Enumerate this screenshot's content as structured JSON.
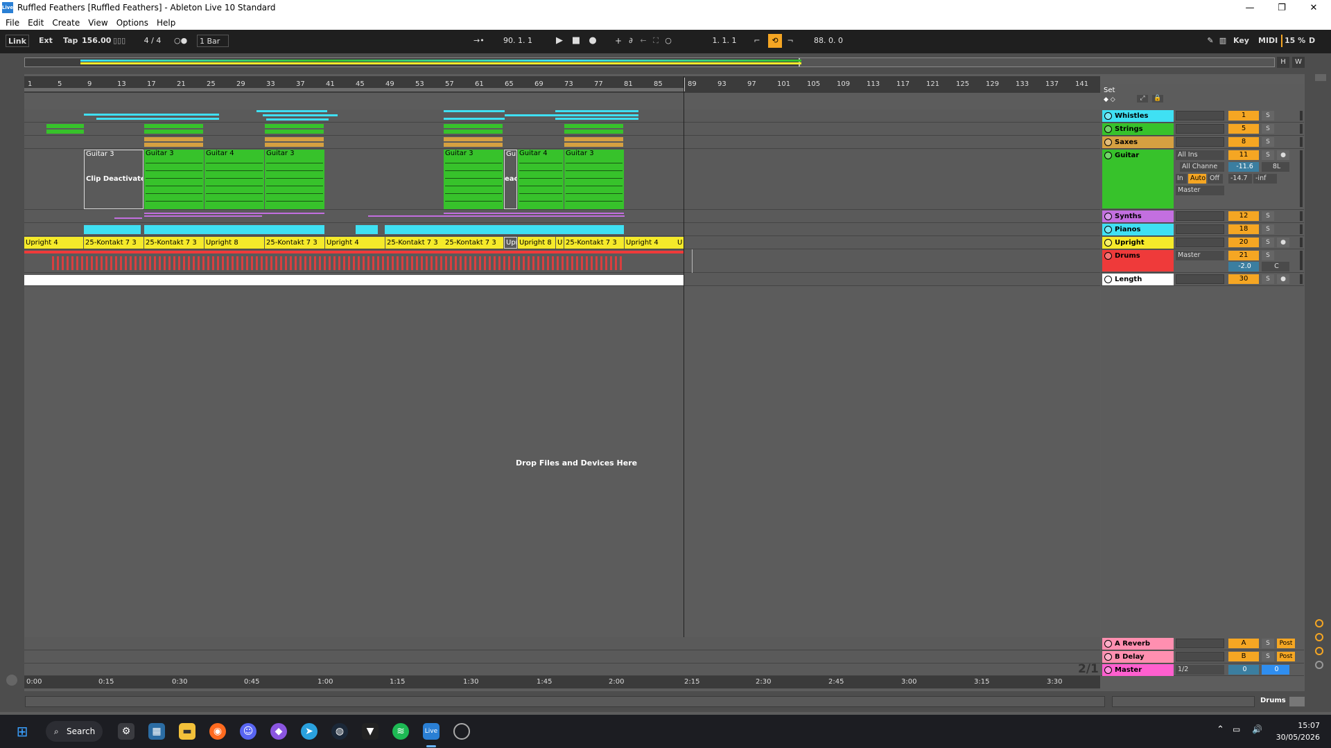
{
  "window": {
    "title": "Ruffled Feathers  [Ruffled Feathers] - Ableton Live 10 Standard",
    "app_icon": "Live",
    "minimize": "—",
    "maximize": "❐",
    "close": "✕"
  },
  "menu": [
    "File",
    "Edit",
    "Create",
    "View",
    "Options",
    "Help"
  ],
  "transport": {
    "link": "Link",
    "ext": "Ext",
    "tap": "Tap",
    "tempo": "156.00",
    "time_sig": "4 / 4",
    "metronome": "○●",
    "quantize": "1 Bar",
    "arrangement_pos": "90.  1.  1",
    "loop_start": "1.  1.  1",
    "loop_length": "88.  0.  0",
    "key": "Key",
    "midi": "MIDI",
    "cpu": "15 %",
    "d": "D"
  },
  "overview": {
    "h": "H",
    "w": "W"
  },
  "ruler": {
    "bars": [
      "1",
      "5",
      "9",
      "13",
      "17",
      "21",
      "25",
      "29",
      "33",
      "37",
      "41",
      "45",
      "49",
      "53",
      "57",
      "61",
      "65",
      "69",
      "73",
      "77",
      "81",
      "85",
      "89",
      "93",
      "97",
      "101",
      "105",
      "109",
      "113",
      "117",
      "121",
      "125",
      "129",
      "133",
      "137",
      "141"
    ],
    "set_label": "Set"
  },
  "time_ruler": [
    "0:00",
    "0:15",
    "0:30",
    "0:45",
    "1:00",
    "1:15",
    "1:30",
    "1:45",
    "2:00",
    "2:15",
    "2:30",
    "2:45",
    "3:00",
    "3:15",
    "3:30"
  ],
  "clips": {
    "guitar_deactivated": "Guitar 3",
    "deactivated_label": "Clip Deactivated",
    "guitar": [
      "Guitar 3",
      "Guitar 4",
      "Guitar 3",
      "Guitar 3",
      "Gui",
      "Guitar 4",
      "Guitar 3"
    ],
    "deact_short": "eact",
    "upright": [
      "Upright 4",
      "25-Kontakt 7 3",
      "25-Kontakt 7 3",
      "Upright 8",
      "25-Kontakt 7 3",
      "Upright 4",
      "25-Kontakt 7 3",
      "25-Kontakt 7 3",
      "Upr",
      "Upright 8",
      "U",
      "25-Kontakt 7 3",
      "Upright 4",
      "U"
    ]
  },
  "drop_message": "Drop Files and Devices Here",
  "page_indicator": "2/1",
  "tracks": [
    {
      "name": "Whistles",
      "color": "#3fe0f3",
      "num": "1",
      "solo": "S"
    },
    {
      "name": "Strings",
      "color": "#37c22b",
      "num": "5",
      "solo": "S"
    },
    {
      "name": "Saxes",
      "color": "#d5a041",
      "num": "8",
      "solo": "S"
    },
    {
      "name": "Guitar",
      "color": "#37c22b",
      "num": "11",
      "solo": "S",
      "input": "All Ins",
      "channel": "All Channe",
      "mon_in": "In",
      "mon_auto": "Auto",
      "mon_off": "Off",
      "out": "Master",
      "vol": "-11.6",
      "pan": "8L",
      "send": "-14.7",
      "peak": "-inf"
    },
    {
      "name": "Synths",
      "color": "#c36fe0",
      "num": "12",
      "solo": "S"
    },
    {
      "name": "Pianos",
      "color": "#3fe0f3",
      "num": "18",
      "solo": "S"
    },
    {
      "name": "Upright",
      "color": "#f5ea2a",
      "num": "20",
      "solo": "S"
    },
    {
      "name": "Drums",
      "color": "#ef3a3a",
      "num": "21",
      "solo": "S",
      "out": "Master",
      "vol": "-2.0",
      "pan": "C"
    },
    {
      "name": "Length",
      "color": "#ffffff",
      "num": "30",
      "solo": "S"
    }
  ],
  "returns": [
    {
      "name": "A Reverb",
      "color": "#ff8fb0",
      "letter": "A",
      "solo": "S",
      "post": "Post"
    },
    {
      "name": "B Delay",
      "color": "#ff8fb0",
      "letter": "B",
      "solo": "S",
      "post": "Post"
    },
    {
      "name": "Master",
      "color": "#ff5fcf",
      "out": "1/2",
      "vol": "0",
      "pan": "0"
    }
  ],
  "status": {
    "drums_label": "Drums"
  },
  "taskbar": {
    "search": "Search",
    "time": "15:07",
    "date": "30/05/2026"
  },
  "colors": {
    "accent_orange": "#f5a623",
    "guitar_green": "#37c22b",
    "whistle_cyan": "#3fe0f3",
    "upright_yellow": "#f5ea2a",
    "drums_red": "#ef3a3a"
  }
}
